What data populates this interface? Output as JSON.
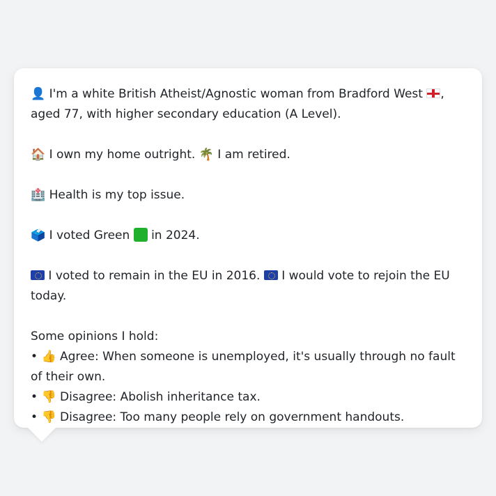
{
  "profile": {
    "identity_icon": "👤",
    "identity_text_a": "I'm a white British Atheist/Agnostic woman from Bradford West",
    "identity_flag": "england-flag-icon",
    "identity_text_b": ", aged 77, with higher secondary education (A Level).",
    "home_icon": "🏠",
    "home_text": "I own my home outright.",
    "retired_icon": "🌴",
    "retired_text": "I am retired.",
    "health_icon": "🏥",
    "health_text": "Health is my top issue.",
    "vote_icon": "🗳️",
    "vote_text_a": "I voted Green",
    "vote_text_b": "in 2024.",
    "eu_text_a": "I voted to remain in the EU in 2016.",
    "eu_text_b": "I would vote to rejoin the EU today.",
    "opinions_heading": "Some opinions I hold:",
    "opinions": [
      {
        "bullet": "•",
        "icon": "👍",
        "text": "Agree: When someone is unemployed, it's usually through no fault of their own."
      },
      {
        "bullet": "•",
        "icon": "👎",
        "text": "Disagree: Abolish inheritance tax."
      },
      {
        "bullet": "•",
        "icon": "👎",
        "text": "Disagree: Too many people rely on government handouts."
      }
    ]
  },
  "colors": {
    "background": "#f2f3f5",
    "card": "#ffffff",
    "text": "#1f2328",
    "green": "#1fb02e",
    "eu_blue": "#1f3fa8"
  }
}
